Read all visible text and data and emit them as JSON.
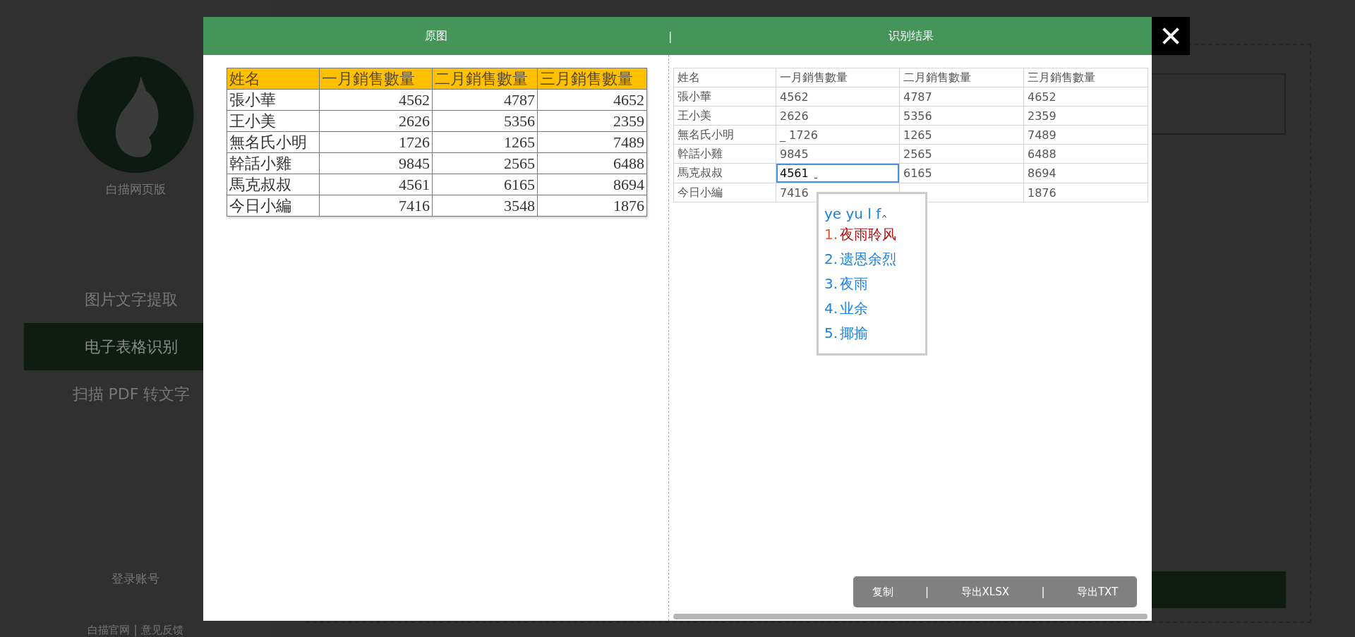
{
  "sidebar": {
    "app_name": "白描网页版",
    "menu": [
      {
        "label": "图片文字提取",
        "selected": false
      },
      {
        "label": "电子表格识别",
        "selected": true
      },
      {
        "label": "扫描 PDF 转文字",
        "selected": false
      }
    ],
    "login": "登录账号",
    "footer_links": [
      "白描官网",
      "意见反馈"
    ],
    "footer_separator": "|"
  },
  "modal": {
    "header": {
      "left": "原图",
      "separator": "|",
      "right": "识别结果"
    },
    "original_image": {
      "columns": [
        "姓名",
        "一月銷售數量",
        "二月銷售數量",
        "三月銷售數量"
      ],
      "rows": [
        [
          "張小華",
          "4562",
          "4787",
          "4652"
        ],
        [
          "王小美",
          "2626",
          "5356",
          "2359"
        ],
        [
          "無名氏小明",
          "1726",
          "1265",
          "7489"
        ],
        [
          "幹話小雞",
          "9845",
          "2565",
          "6488"
        ],
        [
          "馬克叔叔",
          "4561",
          "6165",
          "8694"
        ],
        [
          "今日小編",
          "7416",
          "3548",
          "1876"
        ]
      ]
    },
    "result_table": {
      "columns": [
        "姓名",
        "一月銷售數量",
        "二月銷售數量",
        "三月銷售數量"
      ],
      "rows": [
        [
          {
            "text": "張小華",
            "editing": false
          },
          {
            "text": "4562",
            "editing": false
          },
          {
            "text": "4787",
            "editing": false
          },
          {
            "text": "4652",
            "editing": false
          }
        ],
        [
          {
            "text": "王小美",
            "editing": false
          },
          {
            "text": "2626",
            "editing": false
          },
          {
            "text": "5356",
            "editing": false
          },
          {
            "text": "2359",
            "editing": false
          }
        ],
        [
          {
            "text": "無名氏小明",
            "editing": false
          },
          {
            "text": "_ 1726",
            "editing": false
          },
          {
            "text": "1265",
            "editing": false
          },
          {
            "text": "7489",
            "editing": false
          }
        ],
        [
          {
            "text": "幹話小雞",
            "editing": false
          },
          {
            "text": "9845",
            "editing": false
          },
          {
            "text": "2565",
            "editing": false
          },
          {
            "text": "6488",
            "editing": false
          }
        ],
        [
          {
            "text": "馬克叔叔",
            "editing": false
          },
          {
            "text": "4561",
            "editing": true
          },
          {
            "text": "6165",
            "editing": false
          },
          {
            "text": "8694",
            "editing": false
          }
        ],
        [
          {
            "text": "今日小編",
            "editing": false
          },
          {
            "text": "7416",
            "editing": false
          },
          {
            "editing": false
          },
          {
            "text": "1876",
            "editing": false
          }
        ]
      ]
    },
    "ime": {
      "composition": "ye yu l f",
      "candidates": [
        {
          "number": "1.",
          "text": "夜雨聆风",
          "selected": true
        },
        {
          "number": "2.",
          "text": "遗恩余烈",
          "selected": false
        },
        {
          "number": "3.",
          "text": "夜雨",
          "selected": false
        },
        {
          "number": "4.",
          "text": "业余",
          "selected": false
        },
        {
          "number": "5.",
          "text": "揶揄",
          "selected": false
        }
      ]
    },
    "actions": {
      "buttons": [
        "复制",
        "导出XLSX",
        "导出TXT"
      ],
      "separator": "|"
    }
  }
}
